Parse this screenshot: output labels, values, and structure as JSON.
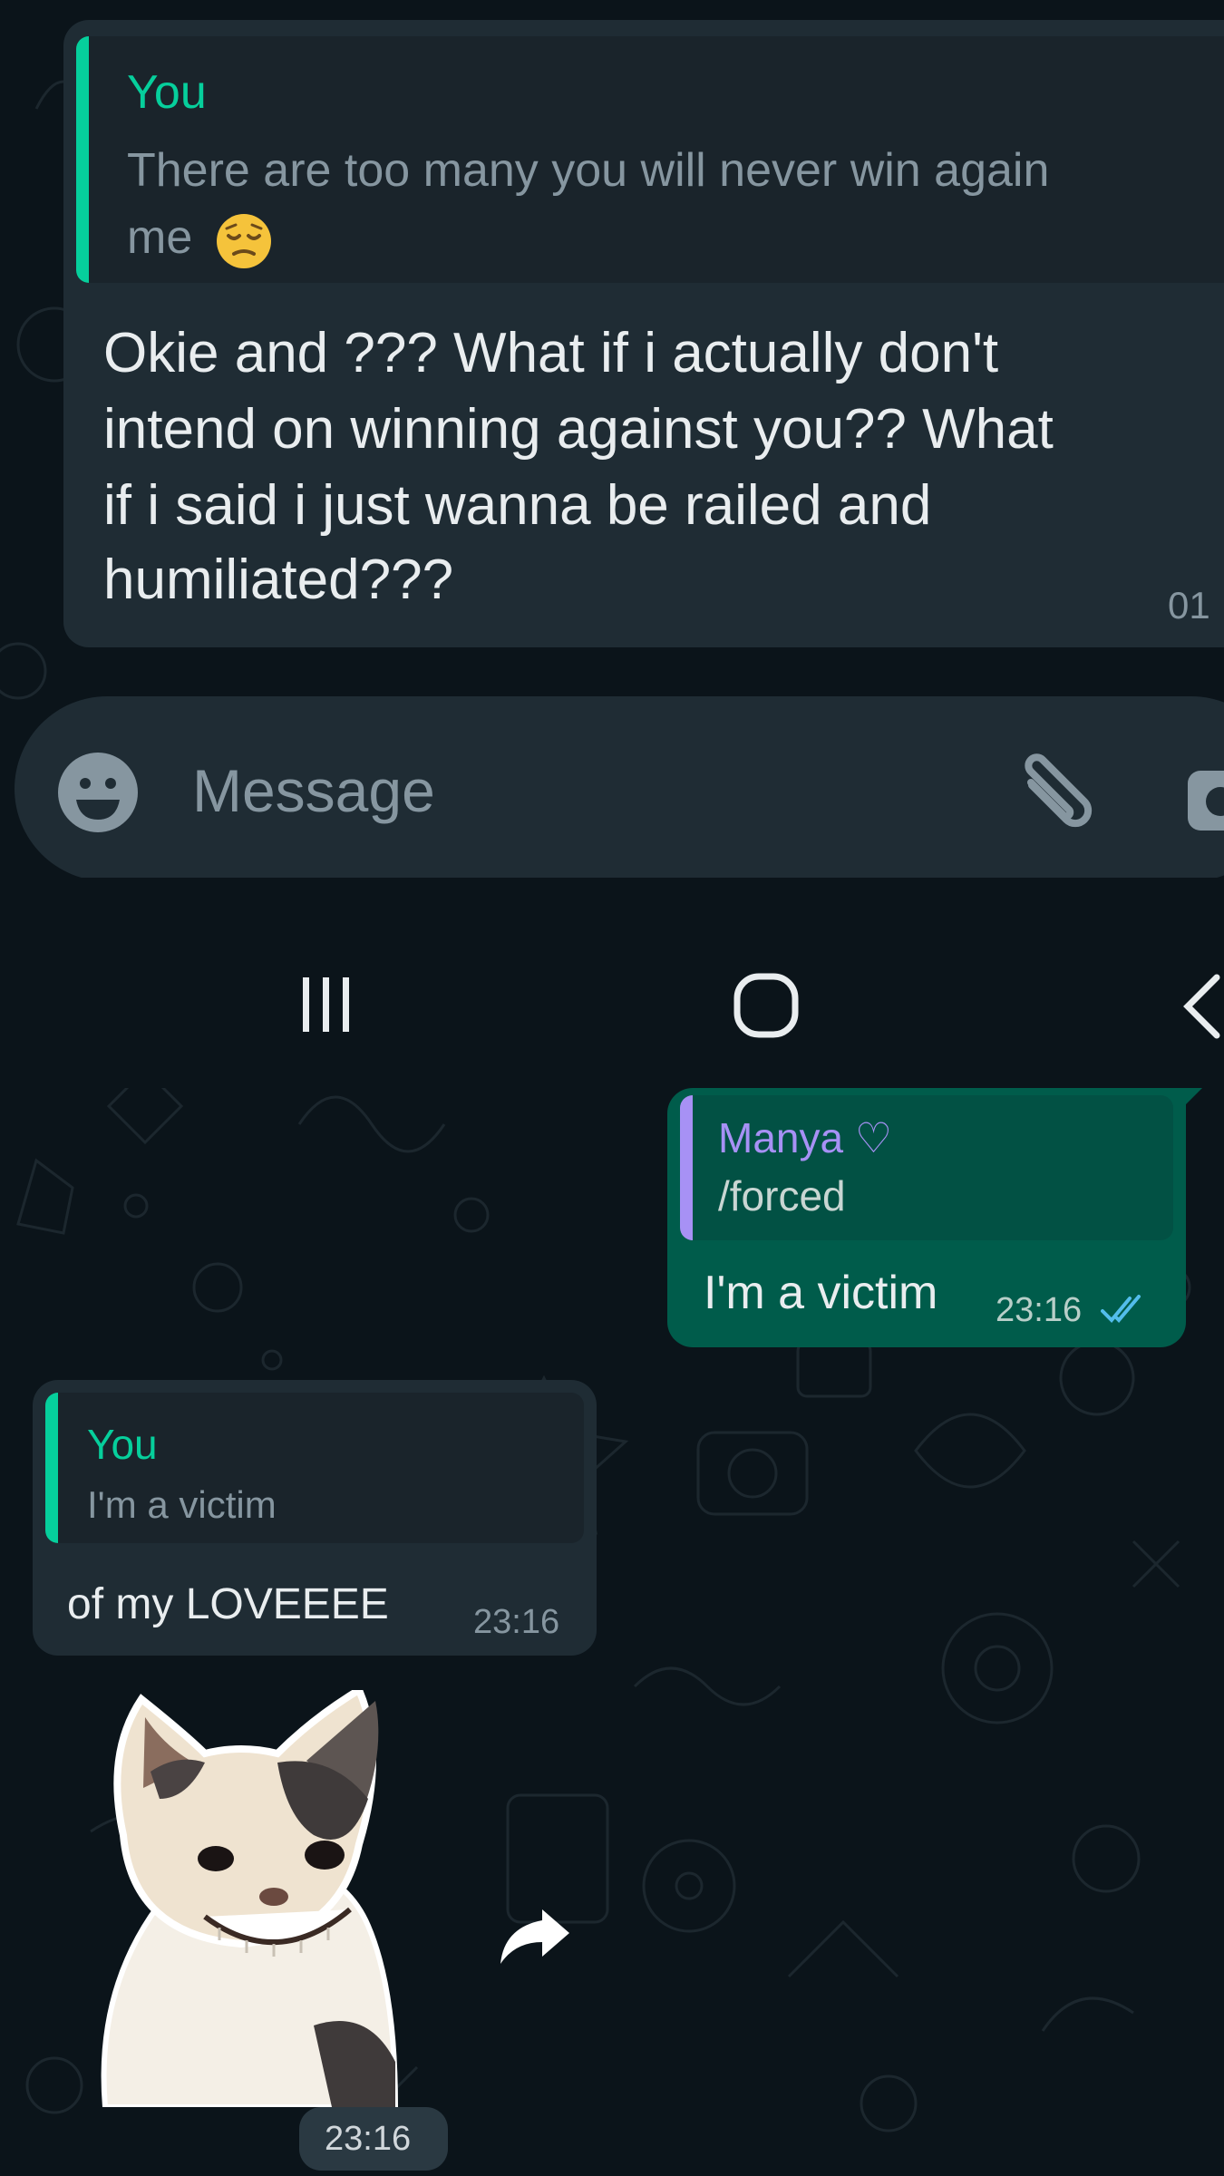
{
  "top": {
    "quote": {
      "author": "You",
      "line1": "There are too many you will never win again",
      "line2": "me",
      "emoji": "pensive-face"
    },
    "message": {
      "line1": "Okie and ??? What if i actually don't",
      "line2": "intend on winning against you?? What",
      "line3": "if i said i just wanna be railed and",
      "line4": "humiliated???",
      "time": "01"
    }
  },
  "composer": {
    "placeholder": "Message",
    "icons": [
      "emoji-icon",
      "paperclip-icon",
      "camera-icon"
    ]
  },
  "navbar": {
    "icons": [
      "recent-apps-icon",
      "home-icon",
      "back-icon"
    ]
  },
  "outgoing": {
    "quote_author": "Manya ♡",
    "quote_text": "/forced",
    "text": "I'm a victim",
    "time": "23:16",
    "status": "read"
  },
  "incoming": {
    "quote_author": "You",
    "quote_text": "I'm a victim",
    "text": "of my LOVEEEE",
    "time": "23:16"
  },
  "sticker": {
    "subject": "smiling cat sticker",
    "time": "23:16"
  },
  "colors": {
    "background": "#0b141a",
    "incoming_bubble": "#1f2c34",
    "outgoing_bubble": "#005c4b",
    "quote_you": "#06cf9c",
    "quote_manya": "#a791f5",
    "read_ticks": "#53bdeb"
  }
}
